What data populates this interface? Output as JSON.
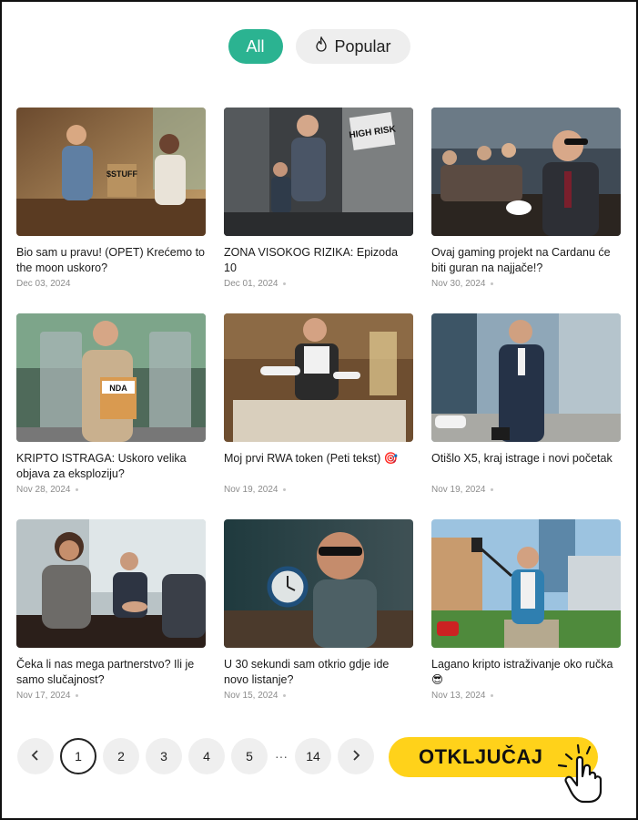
{
  "tabs": {
    "all": "All",
    "popular": "Popular"
  },
  "posts": [
    {
      "title": "Bio sam u pravu! (OPET) Krećemo to the moon uskoro?",
      "date": "Dec 03, 2024",
      "image_text": "$STUFF"
    },
    {
      "title": "ZONA VISOKOG RIZIKA: Epizoda 10",
      "date": "Dec 01, 2024",
      "image_text": "HIGH RISK"
    },
    {
      "title": "Ovaj gaming projekt na Cardanu će biti guran na najjače!?",
      "date": "Nov 30, 2024"
    },
    {
      "title": "KRIPTO ISTRAGA: Uskoro velika objava za eksploziju?",
      "date": "Nov 28, 2024",
      "image_text": "NDA"
    },
    {
      "title": "Moj prvi RWA token (Peti tekst) 🎯",
      "date": "Nov 19, 2024"
    },
    {
      "title": "Otišlo X5, kraj istrage i novi početak",
      "date": "Nov 19, 2024"
    },
    {
      "title": "Čeka li nas mega partnerstvo? Ili je samo slučajnost?",
      "date": "Nov 17, 2024"
    },
    {
      "title": "U 30 sekundi sam otkrio gdje ide novo listanje?",
      "date": "Nov 15, 2024"
    },
    {
      "title": "Lagano kripto istraživanje oko ručka 😎",
      "date": "Nov 13, 2024"
    }
  ],
  "pagination": {
    "prev": "‹",
    "pages": [
      "1",
      "2",
      "3",
      "4",
      "5"
    ],
    "ellipsis": "···",
    "last": "14",
    "next": "›",
    "current": "1"
  },
  "cta": {
    "label": "OTKLJUČAJ"
  },
  "colors": {
    "accent": "#2bb391",
    "cta": "#ffd21a",
    "text": "#1a1a1a",
    "muted": "#8c8c8c"
  },
  "icons": {
    "popular": "flame-icon",
    "prev": "chevron-left-icon",
    "next": "chevron-right-icon",
    "cta": "pointing-hand-icon"
  }
}
